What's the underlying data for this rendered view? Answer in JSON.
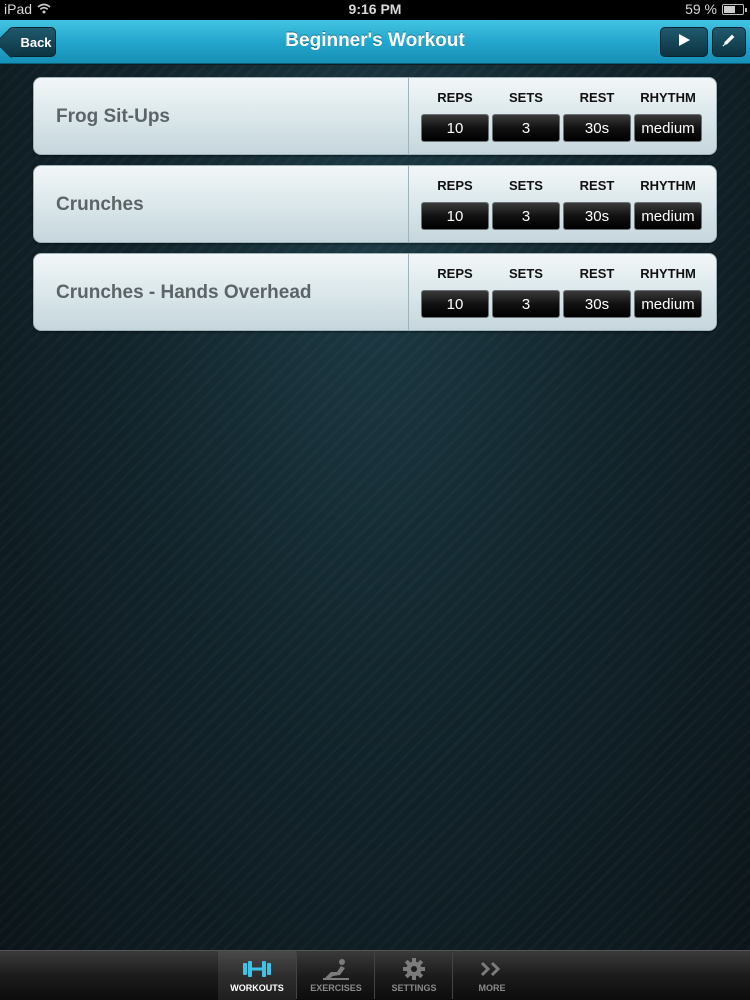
{
  "status_bar": {
    "device": "iPad",
    "time": "9:16 PM",
    "battery_text": "59 %",
    "battery_level": 0.59
  },
  "nav": {
    "title": "Beginner's Workout",
    "back_label": "Back"
  },
  "columns": [
    "REPS",
    "SETS",
    "REST",
    "RHYTHM"
  ],
  "exercises": [
    {
      "name": "Frog Sit-Ups",
      "reps": "10",
      "sets": "3",
      "rest": "30s",
      "rhythm": "medium"
    },
    {
      "name": "Crunches",
      "reps": "10",
      "sets": "3",
      "rest": "30s",
      "rhythm": "medium"
    },
    {
      "name": "Crunches - Hands Overhead",
      "reps": "10",
      "sets": "3",
      "rest": "30s",
      "rhythm": "medium"
    }
  ],
  "tabs": [
    {
      "label": "WORKOUTS",
      "icon": "dumbbell-icon",
      "active": true
    },
    {
      "label": "EXERCISES",
      "icon": "exercise-figure-icon",
      "active": false
    },
    {
      "label": "SETTINGS",
      "icon": "gear-icon",
      "active": false
    },
    {
      "label": "MORE",
      "icon": "double-chevron-right-icon",
      "active": false
    }
  ],
  "colors": {
    "accent": "#24a7cd",
    "active_tab_icon": "#3ec3e6",
    "inactive_tab_icon": "#7b7b7b"
  }
}
